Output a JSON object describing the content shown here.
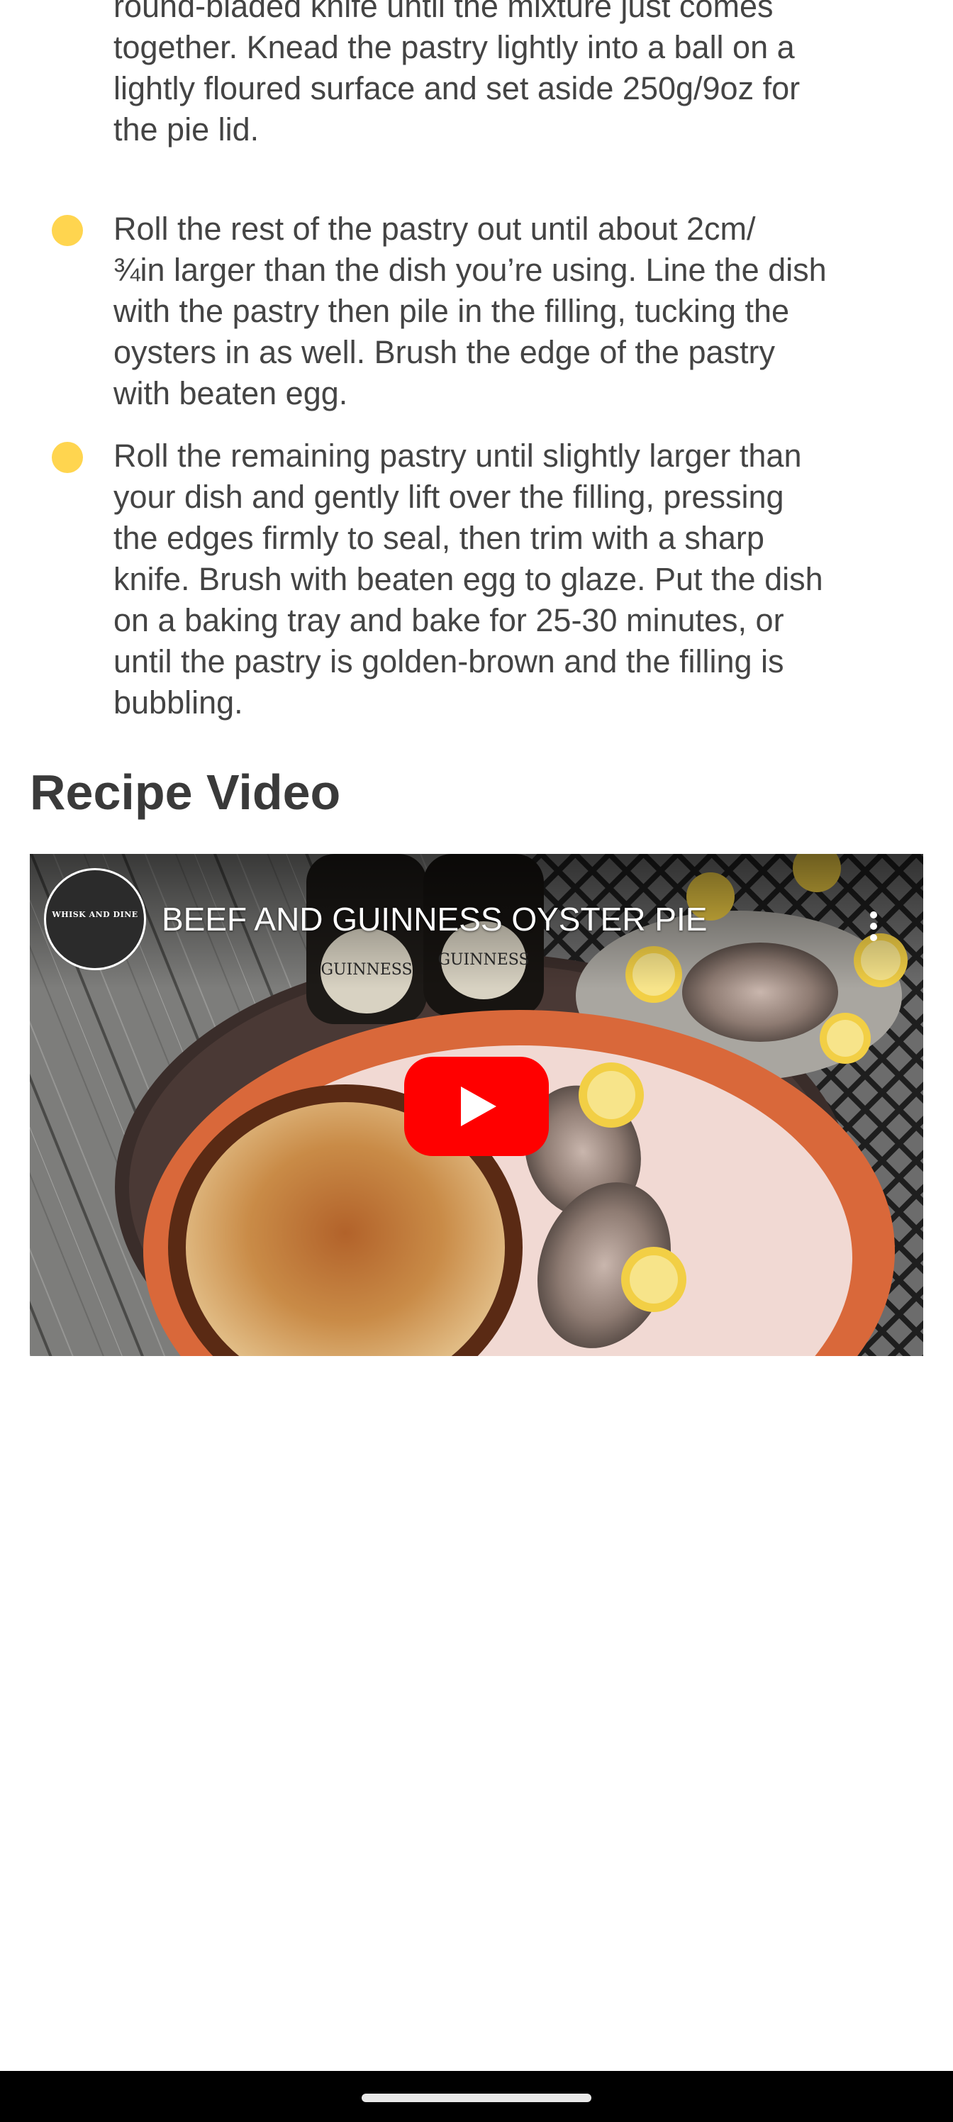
{
  "steps": [
    {
      "partial_first_line": "round-bladed knife until the mixture just comes",
      "lines": [
        "together. Knead the pastry lightly into a ball on a",
        "lightly floured surface and set aside 250g/9oz for",
        "the pie lid."
      ]
    },
    {
      "lines": [
        "Roll the rest of the pastry out until about 2cm/",
        "¾in larger than the dish you’re using. Line the dish",
        "with the pastry then pile in the filling, tucking the",
        "oysters in as well. Brush the edge of the pastry",
        "with beaten egg."
      ]
    },
    {
      "lines": [
        "Roll the remaining pastry until slightly larger than",
        "your dish and gently lift over the filling, pressing",
        "the edges firmly to seal, then trim with a sharp",
        "knife. Brush with beaten egg to glaze. Put the dish",
        "on a baking tray and bake for 25-30 minutes, or",
        "until the pastry is golden-brown and the filling is",
        "bubbling."
      ]
    }
  ],
  "section": {
    "title": "Recipe Video"
  },
  "video": {
    "title": "BEEF AND GUINNESS OYSTER PIE",
    "channel_logo_text": "WHISK AND DINE",
    "play_icon": "youtube-play-icon",
    "menu_icon": "more-vert-icon"
  },
  "colors": {
    "bullet": "#ffd54f",
    "text": "#444444",
    "heading": "#3a3a3a",
    "play_red": "#ff0000",
    "plate_orange": "#d9683a"
  }
}
